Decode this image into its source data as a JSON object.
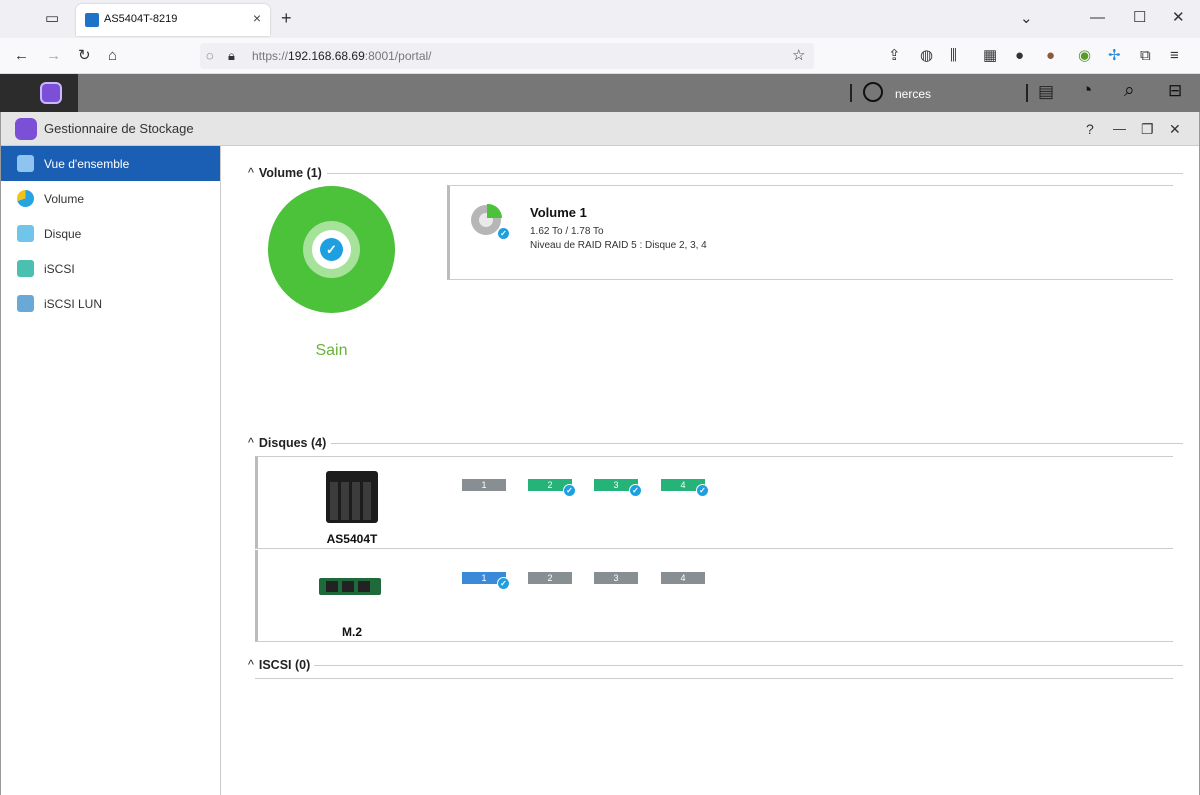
{
  "browser": {
    "tab_title": "AS5404T-8219",
    "tab_close": "×",
    "new_tab": "+",
    "url_prefix": "https://",
    "url_host": "192.168.68.69",
    "url_rest": ":8001/portal/"
  },
  "topbar": {
    "user": "nerces"
  },
  "window": {
    "title": "Gestionnaire de Stockage",
    "help": "?",
    "minimize": "—",
    "restore": "❐",
    "close": "✕"
  },
  "sidebar": {
    "items": [
      {
        "label": "Vue d'ensemble"
      },
      {
        "label": "Volume"
      },
      {
        "label": "Disque"
      },
      {
        "label": "iSCSI"
      },
      {
        "label": "iSCSI LUN"
      }
    ]
  },
  "volume_section": {
    "header": "Volume (1)",
    "status": "Sain",
    "volume": {
      "name": "Volume 1",
      "capacity": "1.62 To / 1.78 To",
      "raid": "Niveau de RAID RAID 5 : Disque 2, 3, 4"
    }
  },
  "disks_section": {
    "header": "Disques (4)",
    "devices": [
      {
        "name": "AS5404T",
        "slots": [
          "1",
          "2",
          "3",
          "4"
        ]
      },
      {
        "name": "M.2",
        "slots": [
          "1",
          "2",
          "3",
          "4"
        ]
      }
    ]
  },
  "iscsi_section": {
    "header": "ISCSI (0)"
  },
  "colors": {
    "healthy": "#4cc13a",
    "active_nav": "#1a5fb4",
    "slot_used": "#25b37a",
    "slot_empty": "#888f93",
    "slot_m2": "#3b8ad9"
  }
}
